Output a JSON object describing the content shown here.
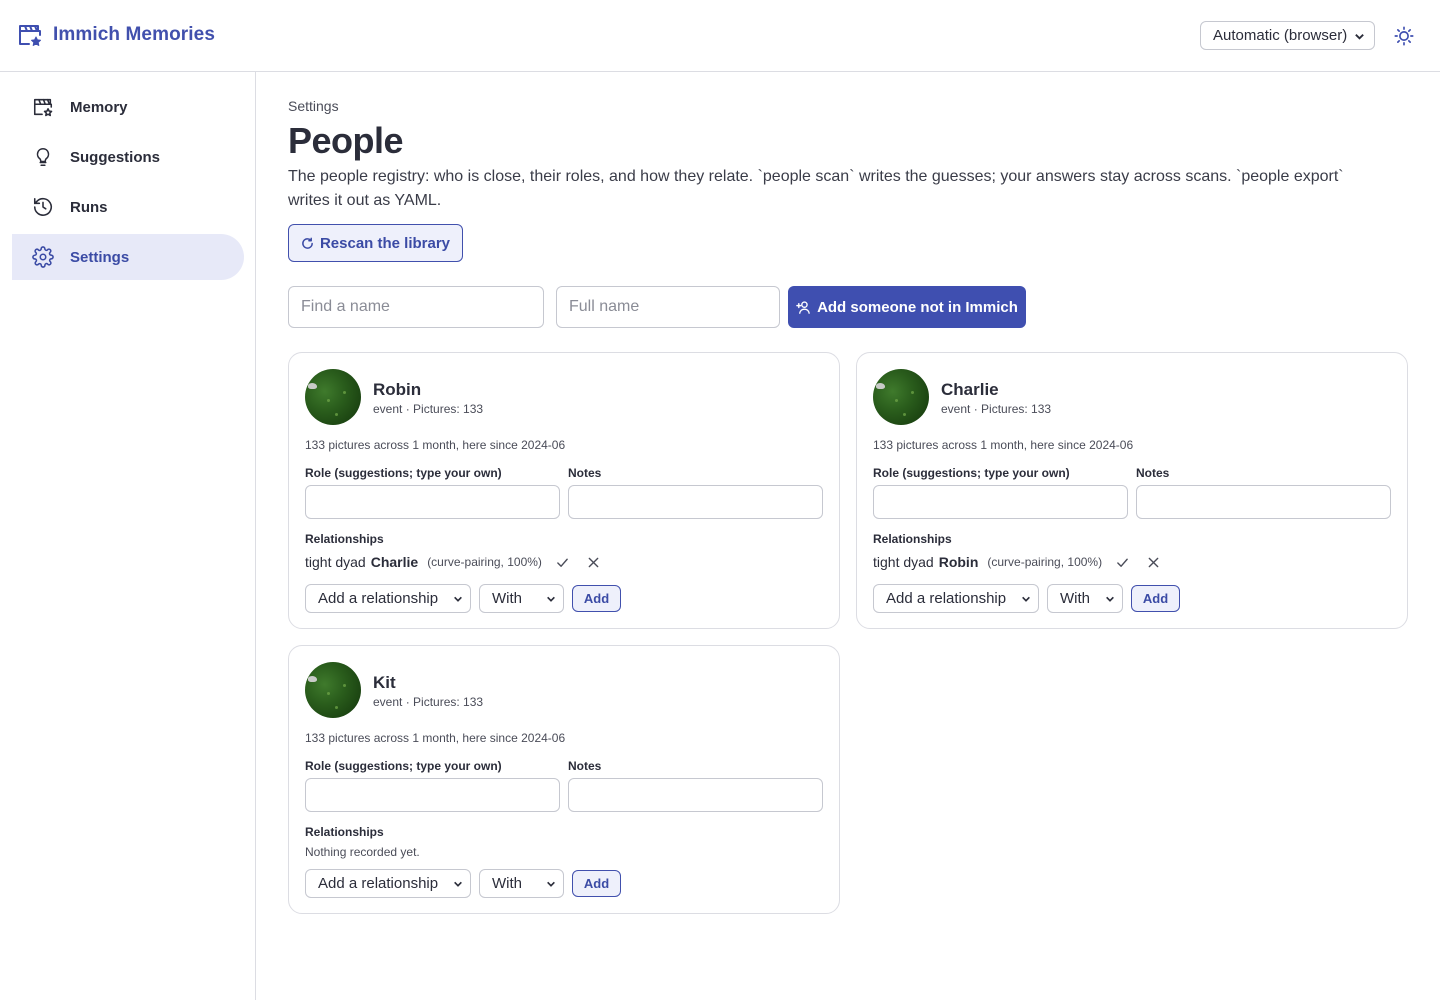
{
  "app": {
    "title": "Immich Memories"
  },
  "header": {
    "theme_select_value": "Automatic (browser)",
    "theme_toggle_icon": "sun-icon"
  },
  "sidebar": {
    "items": [
      {
        "label": "Memory",
        "icon": "clapperboard-icon",
        "active": false
      },
      {
        "label": "Suggestions",
        "icon": "lightbulb-icon",
        "active": false
      },
      {
        "label": "Runs",
        "icon": "history-icon",
        "active": false
      },
      {
        "label": "Settings",
        "icon": "gear-icon",
        "active": true
      }
    ]
  },
  "page": {
    "breadcrumb": "Settings",
    "title": "People",
    "description": "The people registry: who is close, their roles, and how they relate. `people scan` writes the guesses; your answers stay across scans. `people export` writes it out as YAML.",
    "rescan_label": "Rescan the library",
    "find_placeholder": "Find a name",
    "fullname_placeholder": "Full name",
    "add_person_label": "Add someone not in Immich"
  },
  "card_labels": {
    "role_label": "Role (suggestions; type your own)",
    "notes_label": "Notes",
    "relationships_label": "Relationships",
    "add_relationship_select": "Add a relationship",
    "with_select": "With",
    "add_button": "Add",
    "empty_relationships": "Nothing recorded yet."
  },
  "people": [
    {
      "name": "Robin",
      "meta": "event · Pictures: 133",
      "stat": "133 pictures across 1 month, here since 2024-06",
      "relationship": {
        "kind": "tight dyad",
        "with": "Charlie",
        "source": "(curve-pairing, 100%)"
      }
    },
    {
      "name": "Charlie",
      "meta": "event · Pictures: 133",
      "stat": "133 pictures across 1 month, here since 2024-06",
      "relationship": {
        "kind": "tight dyad",
        "with": "Robin",
        "source": "(curve-pairing, 100%)"
      }
    },
    {
      "name": "Kit",
      "meta": "event · Pictures: 133",
      "stat": "133 pictures across 1 month, here since 2024-06",
      "relationship": null
    }
  ],
  "colors": {
    "accent": "#3f4fb0",
    "accent_soft": "#eef0fb",
    "nav_active_bg": "#e7e9f8",
    "border": "#dcdde3"
  }
}
